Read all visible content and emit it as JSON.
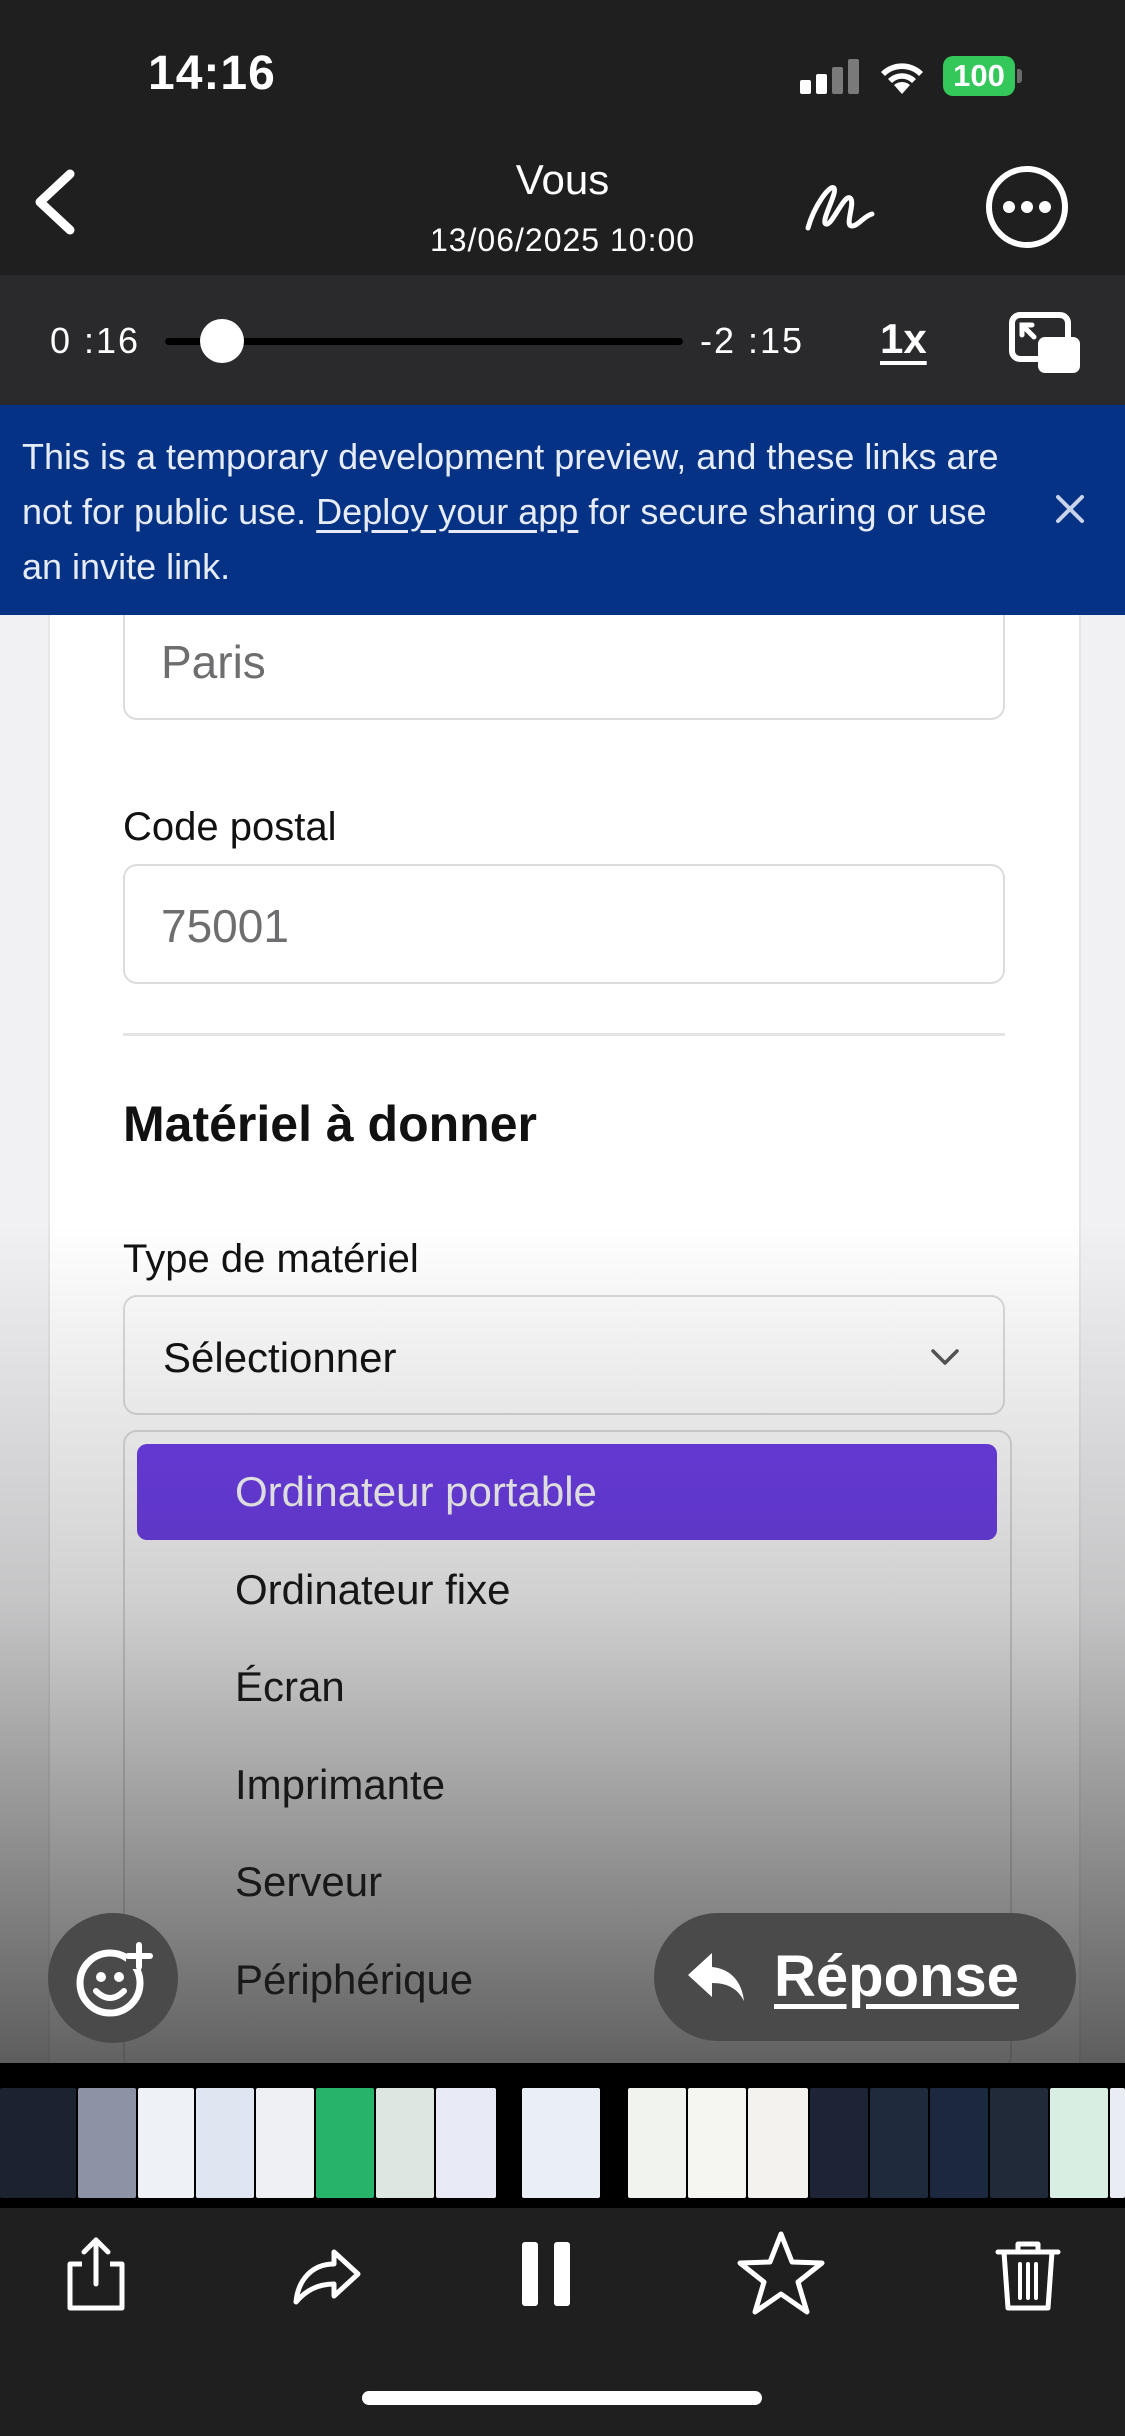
{
  "status_bar": {
    "time": "14:16",
    "battery": "100"
  },
  "header": {
    "title": "Vous",
    "subtitle": "13/06/2025 10:00"
  },
  "playback": {
    "elapsed": "0 :16",
    "remaining": "-2 :15",
    "speed": "1x",
    "progress": 0.11
  },
  "banner": {
    "text_before": "This is a temporary development preview, and these links are not for public use. ",
    "link": "Deploy your app",
    "text_after": " for secure sharing or use an invite link."
  },
  "form": {
    "city_value": "Paris",
    "postal_label": "Code postal",
    "postal_value": "75001",
    "section_title": "Matériel à donner",
    "type_label": "Type de matériel",
    "select_value": "Sélectionner",
    "options": [
      "Ordinateur portable",
      "Ordinateur fixe",
      "Écran",
      "Imprimante",
      "Serveur",
      "Périphérique"
    ],
    "selected_option": 0
  },
  "reply": {
    "label": "Réponse"
  },
  "colors": {
    "banner_bg": "#053284",
    "option_selected": "#6b3aea",
    "battery": "#34c759",
    "chrome_bg": "#1f1f1f"
  },
  "icons": {
    "back": "chevron-left-icon",
    "markup": "markup-signature-icon",
    "more": "ellipsis-circle-icon",
    "pip": "picture-in-picture-icon",
    "close": "close-icon",
    "emoji": "add-reaction-icon",
    "reply": "reply-arrow-icon",
    "share": "share-icon",
    "forward": "forward-icon",
    "pause": "pause-icon",
    "favorite": "star-icon",
    "delete": "trash-icon"
  }
}
